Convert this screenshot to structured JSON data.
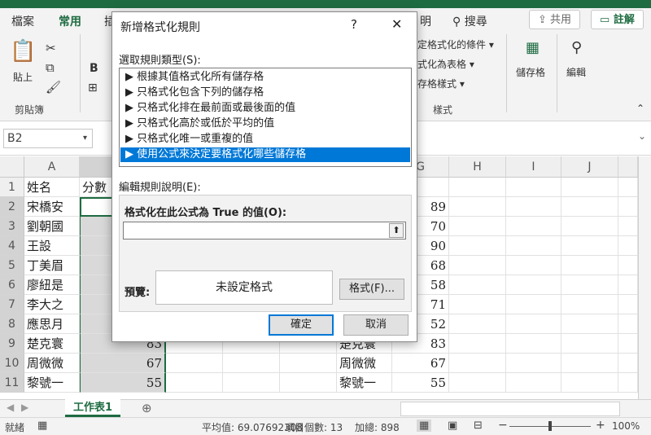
{
  "ribbon": {
    "tabs": [
      "檔案",
      "常用",
      "插",
      "明"
    ],
    "search_label": "搜尋",
    "share_label": "共用",
    "comments_label": "註解",
    "paste_label": "貼上",
    "clipboard_group": "剪貼簿",
    "font_b": "B",
    "cond_format": "定格式化的條件",
    "format_table": "式化為表格",
    "cell_style": "存格樣式",
    "styles_group": "樣式",
    "cells_label": "儲存格",
    "edit_label": "編輯"
  },
  "formula_bar": {
    "name_box": "B2"
  },
  "sheet": {
    "columns": [
      "A",
      "B",
      "G",
      "H",
      "I",
      "J"
    ],
    "row_numbers": [
      "1",
      "2",
      "3",
      "4",
      "5",
      "6",
      "7",
      "8",
      "9",
      "10",
      "11"
    ],
    "header_a": "姓名",
    "header_b": "分數",
    "header_g_fragment": "數",
    "col_a": [
      "宋橋安",
      "劉朝國",
      "王設",
      "丁美眉",
      "廖紐是",
      "李大之",
      "應思月",
      "楚克寰",
      "周微微",
      "黎號一"
    ],
    "col_b_visible": [
      "",
      "",
      "",
      "",
      "",
      "",
      "",
      "83",
      "67",
      "55"
    ],
    "col_f": [
      "楚克寰",
      "周微微",
      "黎號一"
    ],
    "col_g": [
      "89",
      "70",
      "90",
      "68",
      "58",
      "71",
      "52",
      "83",
      "67",
      "55"
    ]
  },
  "sheet_tabs": {
    "active": "工作表1",
    "add": "⊕"
  },
  "status": {
    "ready": "就緒",
    "average": "平均值: 69.07692308",
    "count": "項目個數: 13",
    "sum": "加總: 898",
    "zoom": "100%"
  },
  "dialog": {
    "title": "新增格式化規則",
    "help": "?",
    "close": "✕",
    "select_type_label": "選取規則類型(S):",
    "rule_types": [
      "▶ 根據其值格式化所有儲存格",
      "▶ 只格式化包含下列的儲存格",
      "▶ 只格式化排在最前面或最後面的值",
      "▶ 只格式化高於或低於平均的值",
      "▶ 只格式化唯一或重複的值",
      "▶ 使用公式來決定要格式化哪些儲存格"
    ],
    "selected_index": 5,
    "edit_desc_label": "編輯規則說明(E):",
    "formula_label": "格式化在此公式為 True 的值(O):",
    "formula_value": "",
    "preview_label": "預覽:",
    "preview_text": "未設定格式",
    "format_button": "格式(F)...",
    "ok_button": "確定",
    "cancel_button": "取消"
  },
  "colors": {
    "excel_green": "#1e6c41",
    "selection_blue": "#0078d7"
  }
}
